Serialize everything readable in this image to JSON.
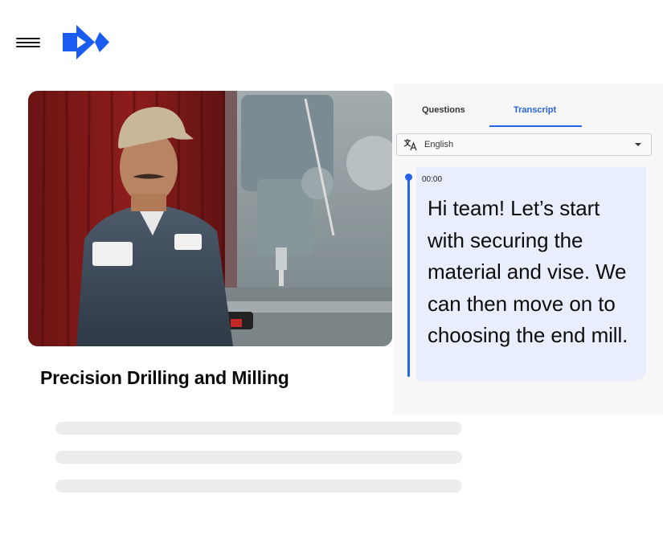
{
  "colors": {
    "accent": "#2563eb",
    "logo": "#1a5cf0",
    "skeleton": "#ececec",
    "cue_bg": "#e9eefc"
  },
  "header": {
    "menu_icon": "hamburger-icon",
    "logo_icon": "play-logo-icon"
  },
  "course": {
    "title": "Precision Drilling and Milling"
  },
  "transcript_panel": {
    "tabs": [
      {
        "label": "Questions",
        "active": false
      },
      {
        "label": "Transcript",
        "active": true
      }
    ],
    "language": {
      "icon": "translate-icon",
      "selected": "English"
    },
    "cues": [
      {
        "time": "00:00",
        "text": "Hi team! Let’s start with securing the material and vise. We can then move on to choosing the end mill."
      }
    ]
  }
}
